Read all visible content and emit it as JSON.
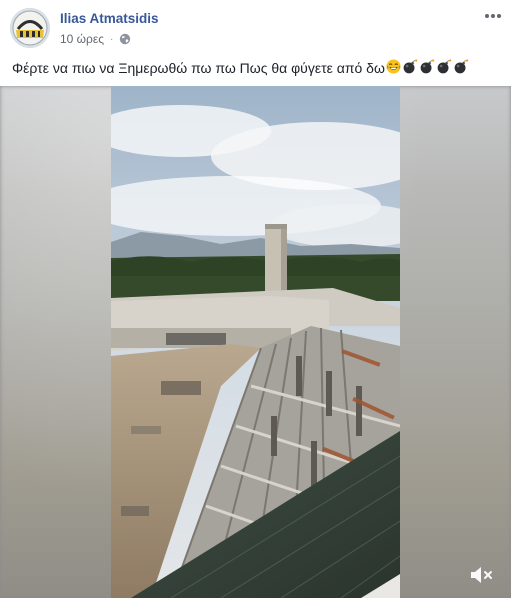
{
  "post": {
    "author": "Ilias Atmatsidis",
    "timestamp": "10 ώρες",
    "privacy_icon": "globe-icon",
    "menu_icon": "more-options-icon",
    "caption": "Φέρτε να πιω να Ξημερωθώ πω πω Πως θα φύγετε από δω",
    "caption_emojis": [
      "laughing-crying-emoji",
      "bomb-emoji",
      "bomb-emoji",
      "bomb-emoji",
      "bomb-emoji"
    ]
  },
  "video": {
    "subject": "stadium-construction-video",
    "mute_icon": "speaker-muted-icon"
  },
  "colors": {
    "author_link": "#385898",
    "meta_text": "#616770",
    "body_text": "#1d2129",
    "sky": "#c5d3e2",
    "hills": "#8b9aa4",
    "trees": "#354a2a",
    "concrete": "#c9c6bd",
    "ground": "#b09e87"
  }
}
